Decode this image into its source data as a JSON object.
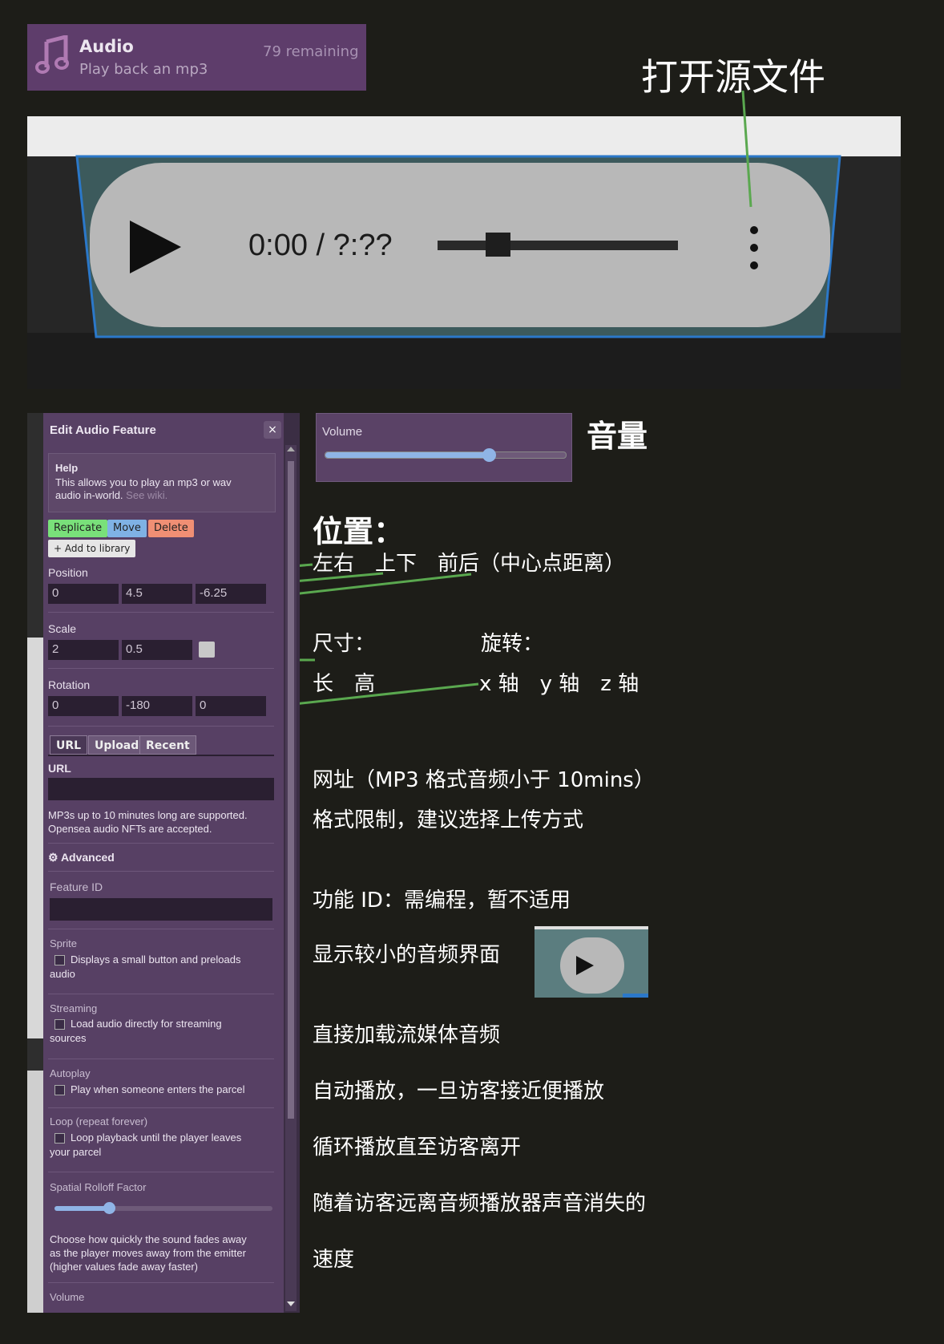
{
  "card": {
    "title": "Audio",
    "subtitle": "Play back an mp3",
    "remaining": "79 remaining",
    "icon": "music-note-icon"
  },
  "annotations": {
    "open_source": "打开源文件",
    "volume": "音量",
    "position_title": "位置：",
    "position_axes": "左右　上下　前后（中心点距离）",
    "size_title": "尺寸：",
    "rotation_title": "旋转：",
    "size_axes": "长　高",
    "rotation_axes": "x 轴　y 轴　z 轴",
    "url_note": "网址（MP3 格式音频小于 10mins）",
    "format_note": "格式限制，建议选择上传方式",
    "feature_id_note": "功能 ID：需编程，暂不适用",
    "sprite_note": "显示较小的音频界面",
    "streaming_note": "直接加载流媒体音频",
    "autoplay_note": "自动播放，一旦访客接近便播放",
    "loop_note": "循环播放直至访客离开",
    "rolloff_note": "随着访客远离音频播放器声音消失的",
    "rolloff_note2": "速度"
  },
  "player": {
    "time": "0:00 / ?:??",
    "progress_fraction": 0.25
  },
  "panel": {
    "title": "Edit Audio Feature",
    "close": "×",
    "help_title": "Help",
    "help_text1": "This allows you to play an mp3 or wav",
    "help_text2": "audio in-world.",
    "help_link": "See wiki.",
    "buttons": {
      "replicate": "Replicate",
      "move": "Move",
      "delete": "Delete",
      "add_library": "+ Add to library"
    },
    "position_label": "Position",
    "position": [
      "0",
      "4.5",
      "-6.25"
    ],
    "scale_label": "Scale",
    "scale": [
      "2",
      "0.5"
    ],
    "rotation_label": "Rotation",
    "rotation": [
      "0",
      "-180",
      "0"
    ],
    "tabs": [
      "URL",
      "Upload",
      "Recent"
    ],
    "url_label": "URL",
    "url_value": "",
    "url_help1": "MP3s up to 10 minutes long are supported.",
    "url_help2": "Opensea audio NFTs are accepted.",
    "advanced": "Advanced",
    "feature_id_label": "Feature ID",
    "feature_id_value": "",
    "sprite_label": "Sprite",
    "sprite_text1": "Displays a small button and preloads",
    "sprite_text2": "audio",
    "streaming_label": "Streaming",
    "streaming_text1": "Load audio directly for streaming",
    "streaming_text2": "sources",
    "autoplay_label": "Autoplay",
    "autoplay_text": "Play when someone enters the parcel",
    "loop_label": "Loop (repeat forever)",
    "loop_text1": "Loop playback until the player leaves",
    "loop_text2": "your parcel",
    "rolloff_label": "Spatial Rolloff Factor",
    "rolloff_value": 0.25,
    "rolloff_help1": "Choose how quickly the sound fades away",
    "rolloff_help2": "as the player moves away from the emitter",
    "rolloff_help3": "(higher values fade away faster)",
    "volume_label": "Volume"
  },
  "volume_box": {
    "label": "Volume",
    "value": 0.68
  },
  "colors": {
    "panel_bg": "#574064",
    "card_bg": "#5e3d6b",
    "annotation_line": "#5aa84f",
    "slider_fill": "#8fb4e6",
    "replicate": "#79e07a",
    "move": "#7fb2e5",
    "delete": "#f08f74"
  }
}
